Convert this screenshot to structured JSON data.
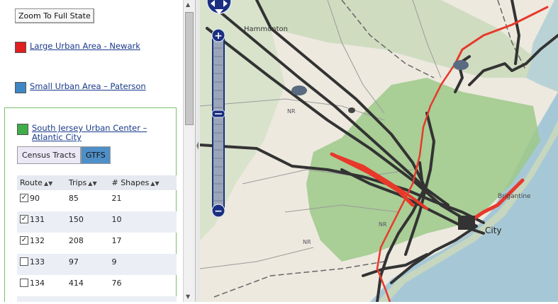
{
  "sidebar": {
    "zoom_button": "Zoom To Full State",
    "legend": [
      {
        "label": "Large Urban Area - Newark",
        "color": "#e02020"
      },
      {
        "label": "Small Urban Area – Paterson",
        "color": "#3f86c4"
      }
    ],
    "south_jersey": {
      "label": "South Jersey Urban Center – Atlantic City",
      "color": "#3fae49",
      "tabs": [
        {
          "label": "Census Tracts",
          "active": false
        },
        {
          "label": "GTFS",
          "active": true
        }
      ],
      "columns": [
        "Route",
        "Trips",
        "# Shapes"
      ],
      "rows": [
        {
          "route": "90",
          "trips": "85",
          "shapes": "21",
          "checked": true
        },
        {
          "route": "131",
          "trips": "150",
          "shapes": "10",
          "checked": true
        },
        {
          "route": "132",
          "trips": "208",
          "shapes": "17",
          "checked": true
        },
        {
          "route": "133",
          "trips": "97",
          "shapes": "9",
          "checked": false
        },
        {
          "route": "134",
          "trips": "414",
          "shapes": "76",
          "checked": false
        }
      ]
    }
  },
  "map": {
    "labels": [
      "Hammonton",
      "City",
      "Brigantine",
      "NR"
    ],
    "colors": {
      "water": "#a6c8d6",
      "land": "#ede9df",
      "urban_area": "#9cc98a",
      "pine_forest": "#bcd7aa",
      "route_red": "#e8382a",
      "route_dark": "#333333"
    }
  },
  "map_controls": {
    "zoom_in": "+",
    "zoom_out": "−"
  }
}
